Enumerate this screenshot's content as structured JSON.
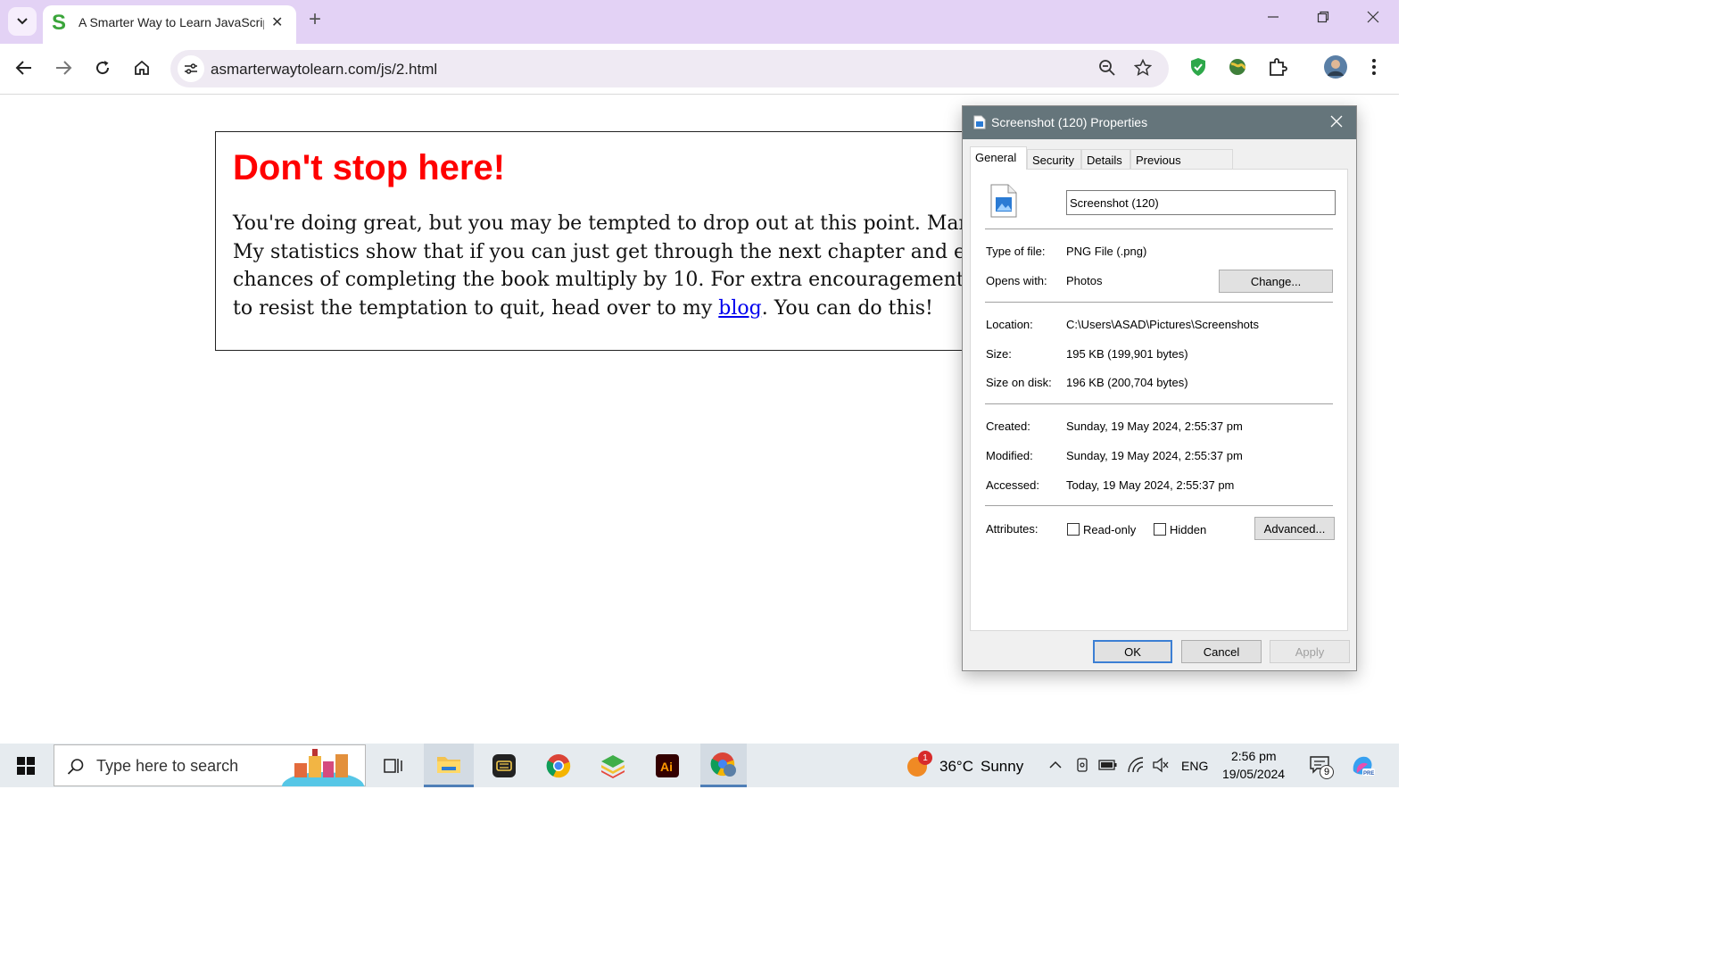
{
  "browser": {
    "tab_title": "A Smarter Way to Learn JavaScript",
    "tab_favicon_letter": "S",
    "url": "asmarterwaytolearn.com/js/2.html",
    "new_tab_glyph": "+",
    "close_tab_glyph": "✕"
  },
  "page": {
    "heading": "Don't stop here!",
    "para_line1": "You're doing great, but you may be tempted to drop out at this point. Many rea",
    "para_line2": "My statistics show that if you can just get through the next chapter and exercise",
    "para_line3": "chances of completing the book multiply by 10. For extra encouragement and ti",
    "para_line4_before": "to resist the temptation to quit, head over to my ",
    "link_text": "blog",
    "para_line4_after": ". You can do this!",
    "heading_color": "#ff0000",
    "link_color": "#0000ee"
  },
  "dialog": {
    "title": "Screenshot (120) Properties",
    "tabs": [
      "General",
      "Security",
      "Details",
      "Previous Versions"
    ],
    "active_tab": "General",
    "file_name": "Screenshot (120)",
    "type_label": "Type of file:",
    "type_value": "PNG File (.png)",
    "opens_label": "Opens with:",
    "opens_value": "Photos",
    "change_button": "Change...",
    "location_label": "Location:",
    "location_value": "C:\\Users\\ASAD\\Pictures\\Screenshots",
    "size_label": "Size:",
    "size_value": "195 KB (199,901 bytes)",
    "size_disk_label": "Size on disk:",
    "size_disk_value": "196 KB (200,704 bytes)",
    "created_label": "Created:",
    "created_value": "Sunday, 19 May 2024, 2:55:37 pm",
    "modified_label": "Modified:",
    "modified_value": "Sunday, 19 May 2024, 2:55:37 pm",
    "accessed_label": "Accessed:",
    "accessed_value": "Today, 19 May 2024, 2:55:37 pm",
    "attributes_label": "Attributes:",
    "readonly_label": "Read-only",
    "hidden_label": "Hidden",
    "advanced_button": "Advanced...",
    "ok_button": "OK",
    "cancel_button": "Cancel",
    "apply_button": "Apply",
    "titlebar_color": "#65757b"
  },
  "taskbar": {
    "search_placeholder": "Type here to search",
    "weather_temp": "36°C",
    "weather_desc": "Sunny",
    "weather_badge": "1",
    "language": "ENG",
    "time": "2:56 pm",
    "date": "19/05/2024",
    "notification_count": "9",
    "pinned": [
      "task-view",
      "file-explorer",
      "keyboard-app",
      "chrome",
      "bluestacks",
      "illustrator",
      "chrome-profile"
    ]
  }
}
